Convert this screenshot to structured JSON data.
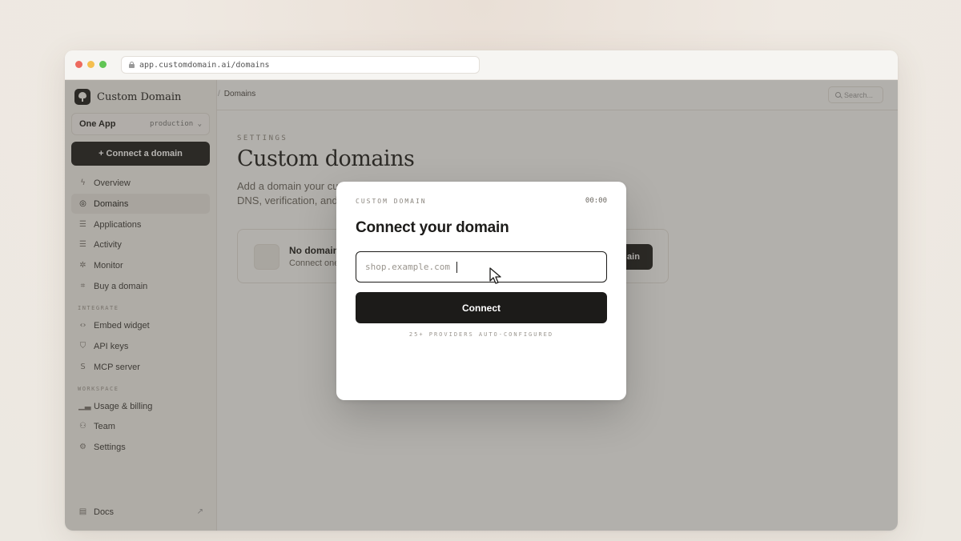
{
  "browser": {
    "url": "app.customdomain.ai/domains"
  },
  "sidebar": {
    "brand": "Custom Domain",
    "app_selector": {
      "name": "One App",
      "env": "production"
    },
    "connect_button": "+ Connect a domain",
    "items": [
      {
        "label": "Overview",
        "icon": "lightning-icon"
      },
      {
        "label": "Domains",
        "icon": "globe-icon",
        "active": true
      },
      {
        "label": "Applications",
        "icon": "stack-icon"
      },
      {
        "label": "Activity",
        "icon": "list-icon"
      },
      {
        "label": "Monitor",
        "icon": "pulse-icon"
      },
      {
        "label": "Buy a domain",
        "icon": "cart-icon"
      }
    ],
    "integrate_label": "INTEGRATE",
    "integrate_items": [
      {
        "label": "Embed widget",
        "icon": "code-icon"
      },
      {
        "label": "API keys",
        "icon": "shield-icon"
      },
      {
        "label": "MCP server",
        "icon": "mcp-icon"
      }
    ],
    "workspace_label": "WORKSPACE",
    "workspace_items": [
      {
        "label": "Usage & billing",
        "icon": "bar-chart-icon"
      },
      {
        "label": "Team",
        "icon": "team-icon"
      },
      {
        "label": "Settings",
        "icon": "gear-icon"
      }
    ],
    "docs": "Docs"
  },
  "topbar": {
    "breadcrumb_sep": "/",
    "breadcrumb": "Domains",
    "search_placeholder": "Search..."
  },
  "main": {
    "eyebrow": "SETTINGS",
    "title": "Custom domains",
    "description_line1": "Add a domain your cust",
    "description_line2": "DNS, verification, and H",
    "empty_title": "No domain",
    "empty_sub": "Connect one",
    "empty_button": "ain"
  },
  "modal": {
    "label": "CUSTOM DOMAIN",
    "timer": "00:00",
    "title": "Connect your domain",
    "input_placeholder": "shop.example.com",
    "input_value": "",
    "button": "Connect",
    "footer": "25+ PROVIDERS AUTO-CONFIGURED"
  },
  "colors": {
    "primary_dark": "#1c1b19",
    "overlay": "rgba(70,66,58,0.40)"
  }
}
